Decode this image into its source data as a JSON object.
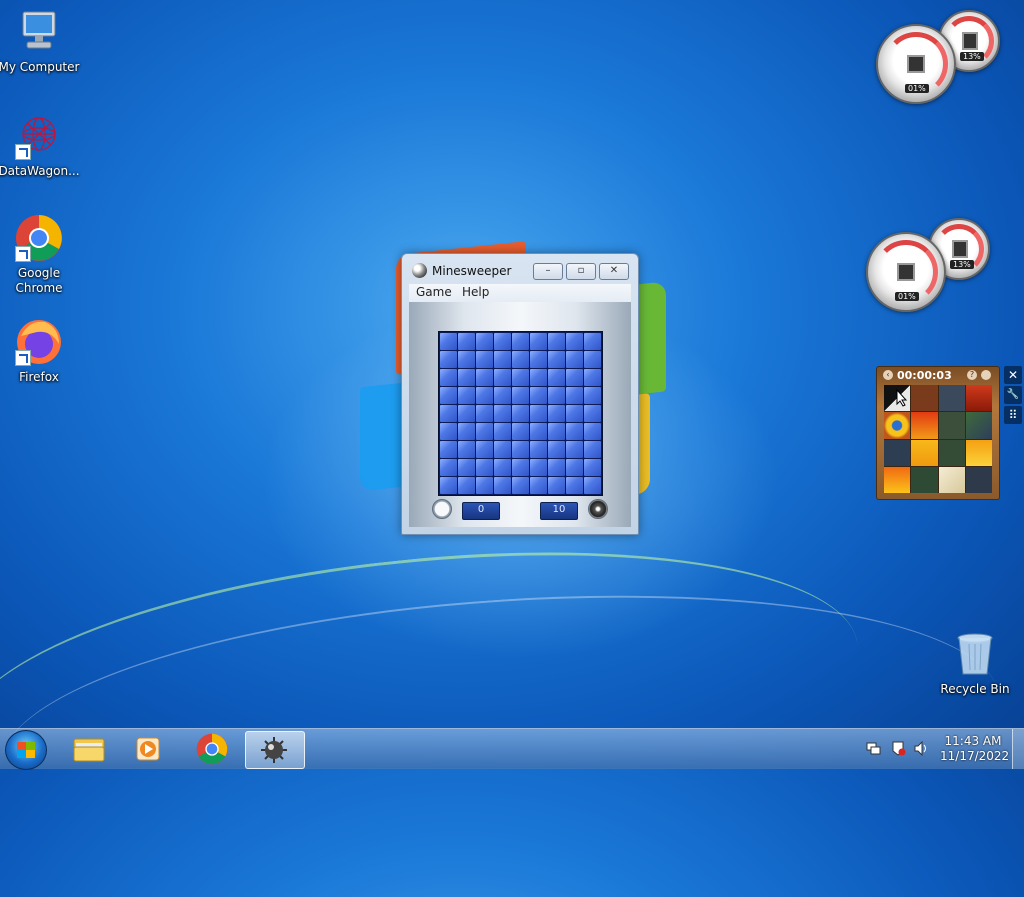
{
  "desktop": {
    "icons": [
      {
        "label": "My Computer"
      },
      {
        "label": "DataWagon..."
      },
      {
        "label": "Google Chrome"
      },
      {
        "label": "Firefox"
      },
      {
        "label": "Recycle Bin"
      }
    ]
  },
  "window": {
    "title": "Minesweeper",
    "menu": {
      "game": "Game",
      "help": "Help"
    },
    "buttons": {
      "minimize": "–",
      "restore": "▫",
      "close": "✕"
    },
    "timer_value": "0",
    "mines_remaining": "10",
    "board": {
      "rows": 9,
      "cols": 9
    }
  },
  "gadgets": {
    "meter1": {
      "cpu": "01%",
      "memory": "13%"
    },
    "meter2": {
      "cpu": "01%",
      "memory": "13%"
    },
    "puzzle": {
      "time": "00:00:03",
      "close": "✕",
      "options": "🔧",
      "drag": "⠿"
    }
  },
  "taskbar": {
    "clock_time": "11:43 AM",
    "clock_date": "11/17/2022"
  }
}
